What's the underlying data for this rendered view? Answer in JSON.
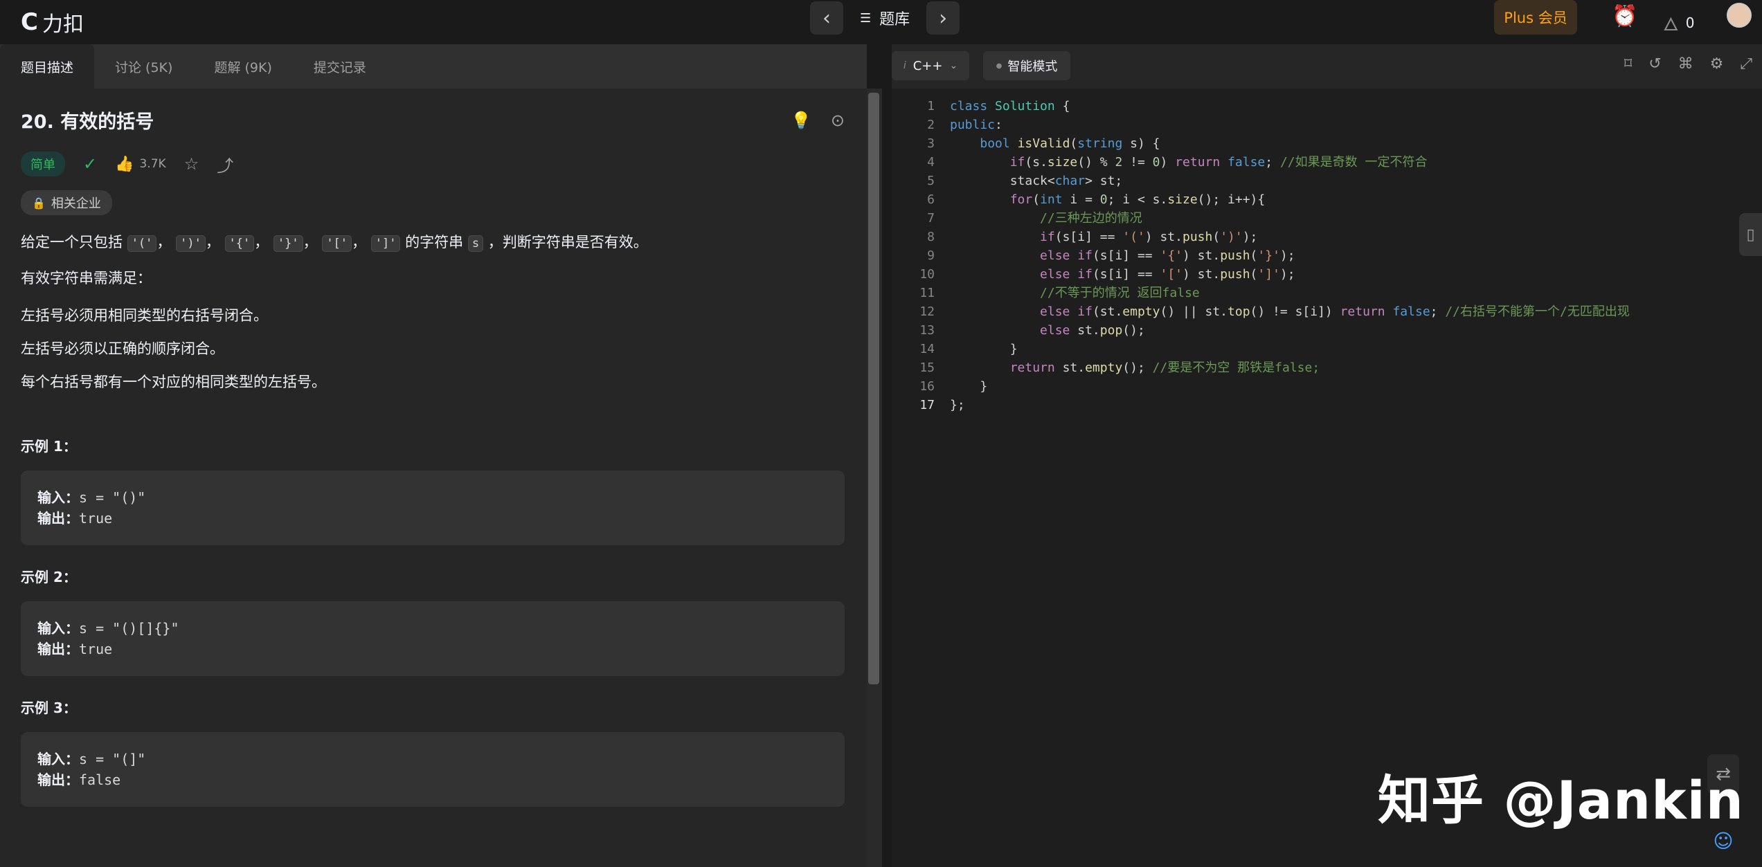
{
  "topbar": {
    "logo_mark": "C",
    "logo_text": "力扣",
    "prev_icon": "‹",
    "next_icon": "›",
    "list_icon": "☰",
    "problemset_label": "题库",
    "plus_label": "Plus 会员",
    "streak_count": "0"
  },
  "tabs": [
    "题目描述",
    "讨论 (5K)",
    "题解 (9K)",
    "提交记录"
  ],
  "problem": {
    "title": "20. 有效的括号",
    "difficulty": "简单",
    "likes": "3.7K",
    "company_label": "相关企业",
    "desc_prefix": "给定一个只包括",
    "desc_codes": [
      "'('",
      "')'",
      "'{'",
      "'}'",
      "'['",
      "']'"
    ],
    "desc_sep": "，",
    "desc_mid": "的字符串",
    "desc_var": "s",
    "desc_suffix": "，判断字符串是否有效。",
    "valid_heading": "有效字符串需满足：",
    "rules": [
      "左括号必须用相同类型的右括号闭合。",
      "左括号必须以正确的顺序闭合。",
      "每个右括号都有一个对应的相同类型的左括号。"
    ],
    "examples": [
      {
        "title": "示例 1：",
        "input_label": "输入：",
        "input": "s = \"()\"",
        "output_label": "输出：",
        "output": "true"
      },
      {
        "title": "示例 2：",
        "input_label": "输入：",
        "input": "s = \"()[]{}\"",
        "output_label": "输出：",
        "output": "true"
      },
      {
        "title": "示例 3：",
        "input_label": "输入：",
        "input": "s = \"(]\"",
        "output_label": "输出：",
        "output": "false"
      }
    ]
  },
  "editor": {
    "language": "C++",
    "mode_label": "智能模式",
    "line_numbers": [
      "1",
      "2",
      "3",
      "4",
      "5",
      "6",
      "7",
      "8",
      "9",
      "10",
      "11",
      "12",
      "13",
      "14",
      "15",
      "16",
      "17"
    ]
  },
  "watermark": "知乎 @Jankin",
  "colors": {
    "accent": "#ffa116",
    "easy": "#2cbb5d",
    "link": "#4a9eff"
  }
}
